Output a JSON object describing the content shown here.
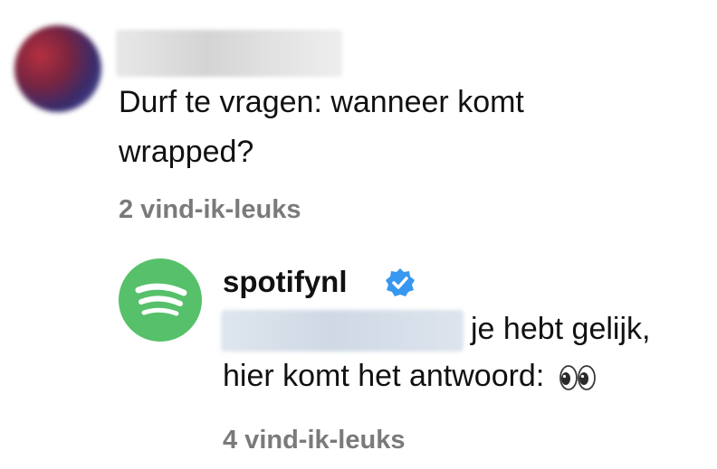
{
  "comment": {
    "text": "Durf te vragen: wanneer komt wrapped?",
    "likes": "2 vind-ik-leuks"
  },
  "reply": {
    "username": "spotifynl",
    "line1": "je hebt gelijk,",
    "line2": "hier komt het antwoord:",
    "likes": "4 vind-ik-leuks"
  },
  "icons": {
    "avatar_spotify": "spotify-logo-icon",
    "verified": "verified-badge-icon",
    "eyes": "eyes-emoji-icon"
  },
  "colors": {
    "spotify_green": "#57c06a",
    "verified_blue": "#3897f0",
    "muted_text": "#7a7a7a"
  }
}
